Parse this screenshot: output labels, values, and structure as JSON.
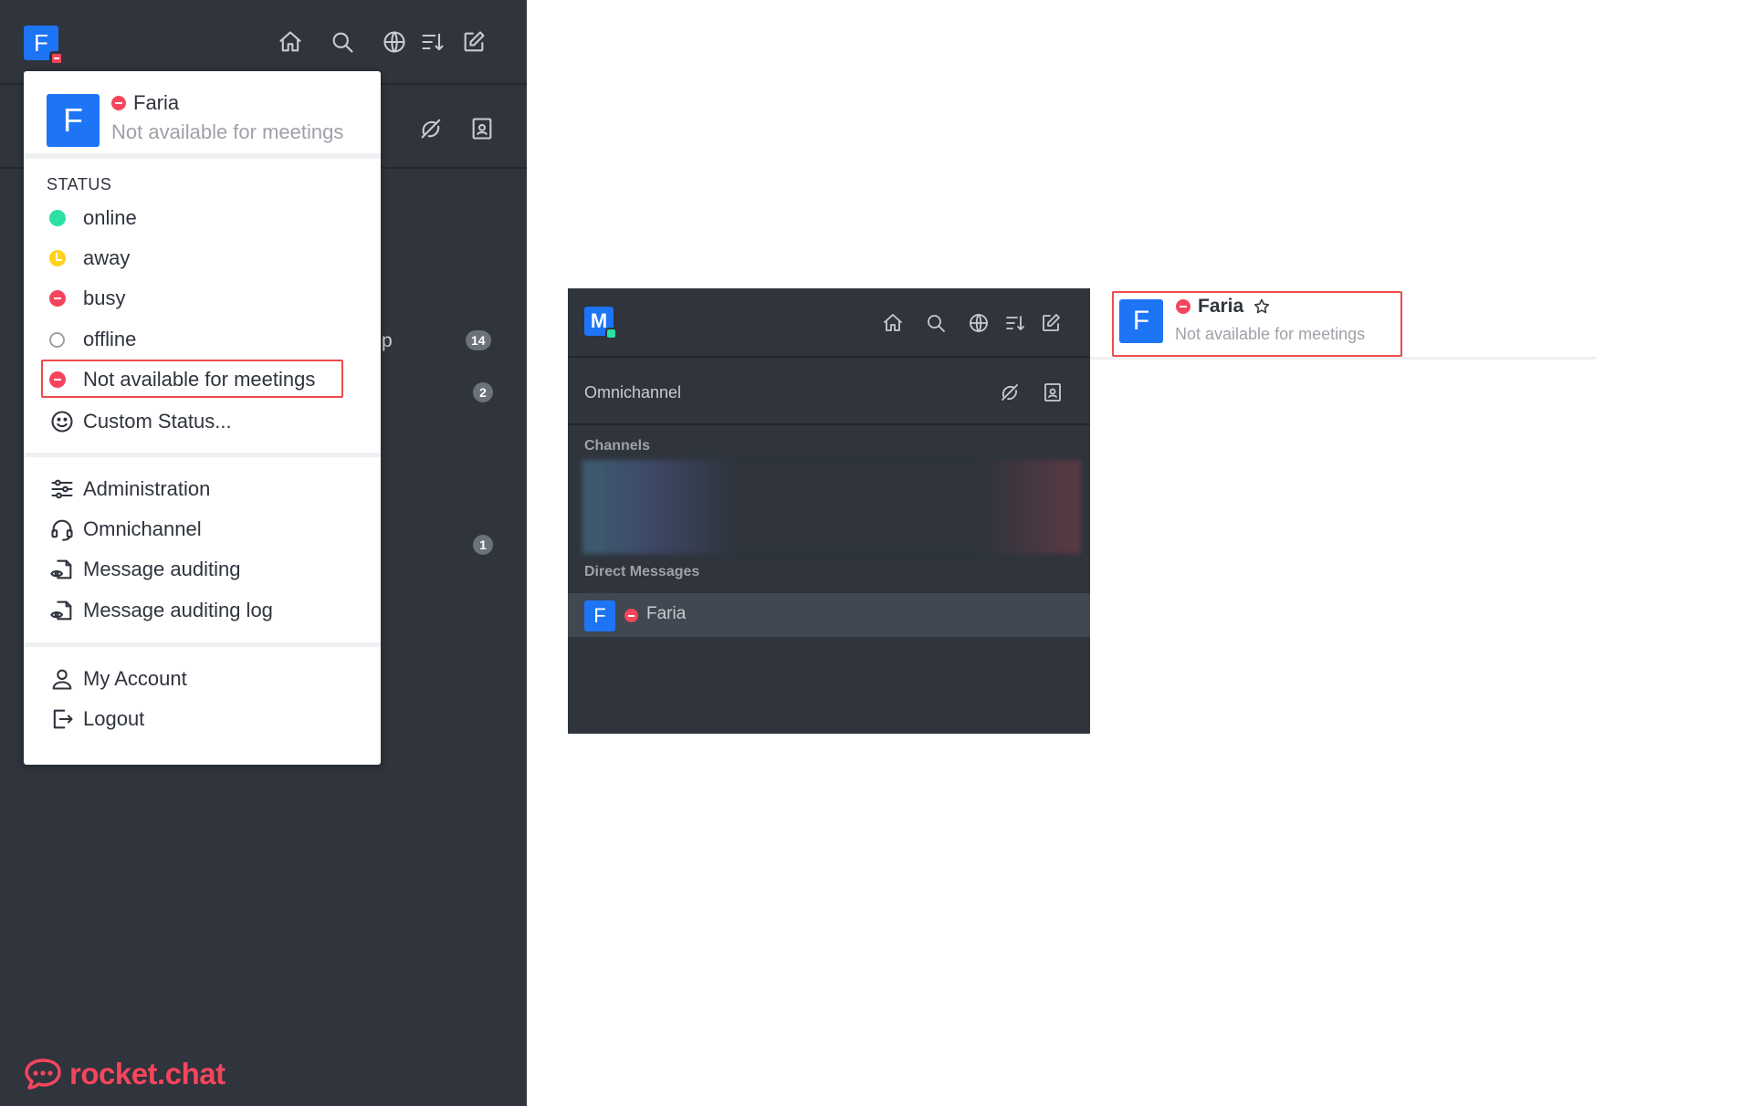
{
  "user": {
    "initial": "F",
    "name": "Faria",
    "status_text": "Not available for meetings"
  },
  "menu": {
    "status_section_label": "STATUS",
    "statuses": [
      {
        "label": "online",
        "icon": "online-dot-icon"
      },
      {
        "label": "away",
        "icon": "away-dot-icon"
      },
      {
        "label": "busy",
        "icon": "busy-dot-icon"
      },
      {
        "label": "offline",
        "icon": "offline-dot-icon"
      },
      {
        "label": "Not available for meetings",
        "icon": "busy-dot-icon",
        "highlighted": true
      },
      {
        "label": "Custom Status...",
        "icon": "smiley-icon"
      }
    ],
    "admin_items": [
      {
        "label": "Administration",
        "icon": "sliders-icon"
      },
      {
        "label": "Omnichannel",
        "icon": "headset-icon"
      },
      {
        "label": "Message auditing",
        "icon": "eye-document-icon"
      },
      {
        "label": "Message auditing log",
        "icon": "eye-document-icon"
      }
    ],
    "account_items": [
      {
        "label": "My Account",
        "icon": "user-icon"
      },
      {
        "label": "Logout",
        "icon": "logout-icon"
      }
    ]
  },
  "sidebar_bg": {
    "badges": [
      "14",
      "2",
      "1"
    ],
    "fragment_text": "p",
    "brand": "rocket.chat"
  },
  "inset": {
    "avatar_initial": "M",
    "omnichannel_label": "Omnichannel",
    "channels_label": "Channels",
    "direct_messages_label": "Direct Messages",
    "dm": {
      "initial": "F",
      "name": "Faria"
    }
  },
  "room_header": {
    "initial": "F",
    "name": "Faria",
    "status_text": "Not available for meetings"
  },
  "colors": {
    "sidebar": "#2f343d",
    "accent": "#1d74f5",
    "busy": "#f5455c",
    "online": "#2de0a5",
    "away": "#ffd21f",
    "highlight": "#ef4b4b"
  }
}
